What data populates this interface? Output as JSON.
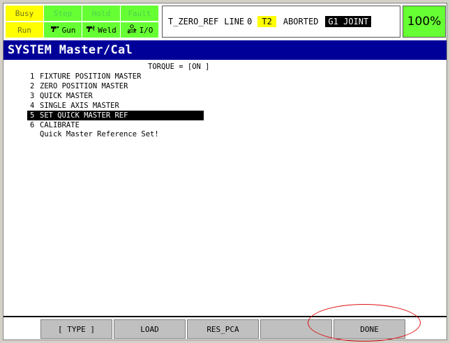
{
  "status_grid": [
    {
      "key": "busy",
      "label": "Busy",
      "active": false
    },
    {
      "key": "step",
      "label": "Step",
      "active": false
    },
    {
      "key": "hold",
      "label": "Hold",
      "active": false
    },
    {
      "key": "fault",
      "label": "Fault",
      "active": false
    },
    {
      "key": "run",
      "label": "Run",
      "active": false
    },
    {
      "key": "gun",
      "label": "Gun",
      "icon": "gun-icon",
      "active": true
    },
    {
      "key": "weld",
      "label": "Weld",
      "icon": "weld-icon",
      "active": true
    },
    {
      "key": "io",
      "label": "I/O",
      "icon": "io-arrows-icon",
      "active": true
    }
  ],
  "program_status": {
    "program_name": "T_ZERO_REF",
    "line_label": "LINE",
    "line_number": "0",
    "mode": "T2",
    "state": "ABORTED",
    "coord": "G1 JOINT"
  },
  "override": "100%",
  "title": "SYSTEM Master/Cal",
  "torque_text": "TORQUE = [ON ]",
  "menu_items": [
    {
      "num": "1",
      "label": "FIXTURE POSITION MASTER",
      "selected": false
    },
    {
      "num": "2",
      "label": "ZERO POSITION MASTER",
      "selected": false
    },
    {
      "num": "3",
      "label": "QUICK MASTER",
      "selected": false
    },
    {
      "num": "4",
      "label": "SINGLE AXIS MASTER",
      "selected": false
    },
    {
      "num": "5",
      "label": "SET QUICK MASTER REF",
      "selected": true
    },
    {
      "num": "6",
      "label": "CALIBRATE",
      "selected": false
    }
  ],
  "message": "Quick Master Reference Set!",
  "function_keys": {
    "f1": "[ TYPE ]",
    "f2": "LOAD",
    "f3": "RES_PCA",
    "f4": "",
    "f5": "DONE"
  },
  "colors": {
    "status_green": "#66ff33",
    "status_yellow": "#ffff00",
    "title_blue": "#000099",
    "annotation_red": "#d11111"
  }
}
